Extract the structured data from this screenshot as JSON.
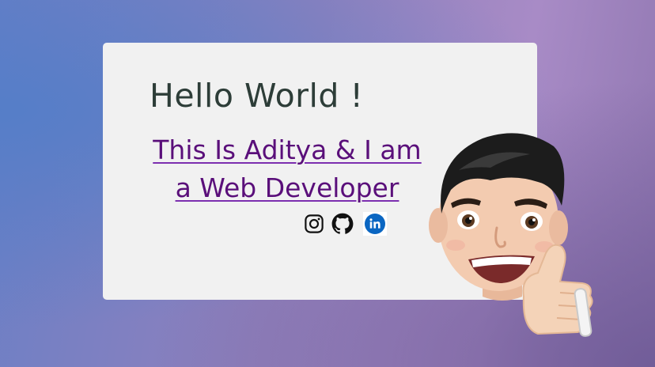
{
  "hero": {
    "greeting": "Hello World !",
    "intro_line1": "This Is Aditya & I am",
    "intro_line2": "a Web Developer"
  },
  "socials": [
    {
      "name": "Instagram",
      "icon": "instagram-icon"
    },
    {
      "name": "GitHub",
      "icon": "github-icon"
    },
    {
      "name": "LinkedIn",
      "icon": "linkedin-icon"
    }
  ],
  "colors": {
    "card_background": "#f1f1f1",
    "greeting_text": "#2d3d38",
    "intro_text": "#5a0f7a",
    "linkedin_blue": "#0a66c2"
  },
  "avatar": {
    "icon": "memoji-thumbs-up-avatar"
  }
}
